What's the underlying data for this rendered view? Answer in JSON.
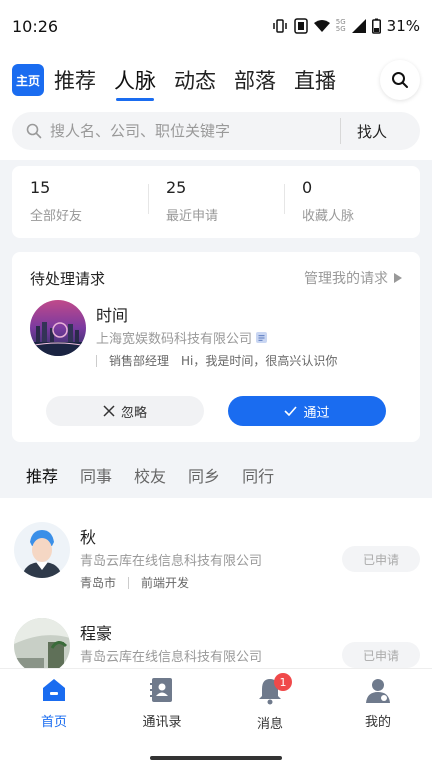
{
  "status_bar": {
    "time": "10:26",
    "network_top": "5G",
    "network_bottom": "5G",
    "battery": "31%"
  },
  "top_nav": {
    "home_badge": "主页",
    "tabs": [
      {
        "label": "推荐"
      },
      {
        "label": "人脉"
      },
      {
        "label": "动态"
      },
      {
        "label": "部落"
      },
      {
        "label": "直播"
      }
    ],
    "active_tab": "人脉"
  },
  "search": {
    "placeholder": "搜人名、公司、职位关键字",
    "button_label": "找人"
  },
  "stats": [
    {
      "value": "15",
      "label": "全部好友"
    },
    {
      "value": "25",
      "label": "最近申请"
    },
    {
      "value": "0",
      "label": "收藏人脉"
    }
  ],
  "pending": {
    "title": "待处理请求",
    "manage_label": "管理我的请求",
    "request": {
      "name": "时间",
      "company": "上海宽娱数码科技有限公司",
      "position": "销售部经理",
      "message": "Hi，我是时间，很高兴认识你"
    },
    "ignore_label": "忽略",
    "accept_label": "通过"
  },
  "sub_tabs": [
    {
      "label": "推荐"
    },
    {
      "label": "同事"
    },
    {
      "label": "校友"
    },
    {
      "label": "同乡"
    },
    {
      "label": "同行"
    }
  ],
  "people": [
    {
      "name": "秋",
      "company": "青岛云库在线信息科技有限公司",
      "city": "青岛市",
      "position": "前端开发",
      "status": "已申请"
    },
    {
      "name": "程豪",
      "company": "青岛云库在线信息科技有限公司",
      "status": "已申请"
    }
  ],
  "bottom_nav": {
    "items": [
      {
        "label": "首页",
        "icon": "home-icon"
      },
      {
        "label": "通讯录",
        "icon": "contacts-icon"
      },
      {
        "label": "消息",
        "icon": "bell-icon",
        "badge": "1"
      },
      {
        "label": "我的",
        "icon": "user-icon"
      }
    ],
    "active": "首页"
  },
  "colors": {
    "accent": "#1a6cf0",
    "badge": "#f0494a",
    "muted": "#999999"
  }
}
